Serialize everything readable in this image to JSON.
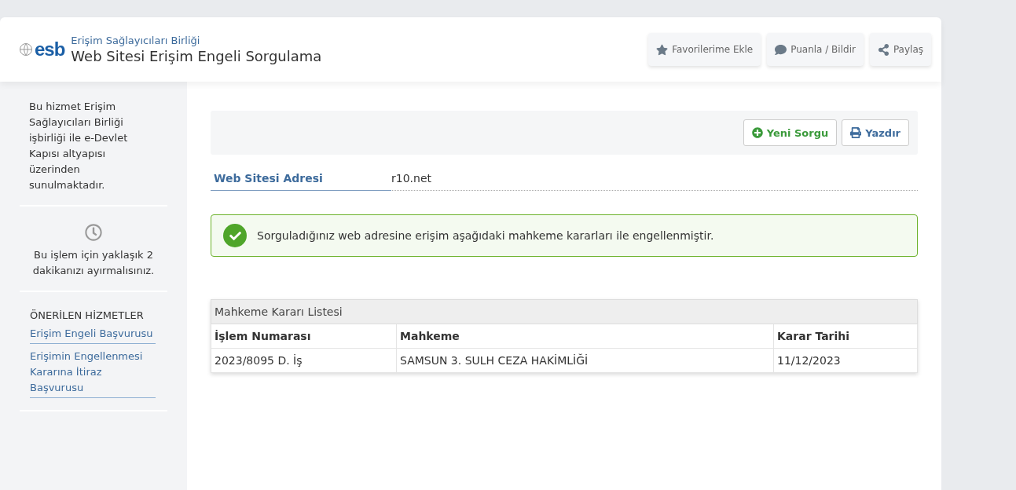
{
  "header": {
    "logo": "esb",
    "subtitle": "Erişim Sağlayıcıları Birliği",
    "title": "Web Sitesi Erişim Engeli Sorgulama",
    "actions": [
      {
        "kind": "star",
        "label": "Favorilerime Ekle"
      },
      {
        "kind": "comment",
        "label": "Puanla / Bildir"
      },
      {
        "kind": "share",
        "label": "Paylaş"
      }
    ]
  },
  "sidebar": {
    "info": "Bu hizmet Erişim Sağlayıcıları Birliği işbirliği ile e-Devlet Kapısı altyapısı üzerinden sunulmaktadır.",
    "duration": "Bu işlem için yaklaşık 2 dakikanızı ayırmalısınız.",
    "related_heading": "ÖNERİLEN HİZMETLER",
    "related": [
      "Erişim Engeli Başvurusu",
      "Erişimin Engellenmesi Kararına İtiraz Başvurusu"
    ]
  },
  "toolbar": [
    {
      "kind": "new",
      "label": "Yeni Sorgu"
    },
    {
      "kind": "print",
      "label": "Yazdır"
    }
  ],
  "field": {
    "label": "Web Sitesi Adresi",
    "value": "r10.net"
  },
  "alert": "Sorguladığınız web adresine erişim aşağıdaki mahkeme kararları ile engellenmiştir.",
  "table": {
    "title": "Mahkeme Kararı Listesi",
    "columns": [
      "İşlem Numarası",
      "Mahkeme",
      "Karar Tarihi"
    ],
    "rows": [
      [
        "2023/8095 D. İş",
        "SAMSUN 3. SULH CEZA HAKİMLİĞİ",
        "11/12/2023"
      ]
    ]
  }
}
